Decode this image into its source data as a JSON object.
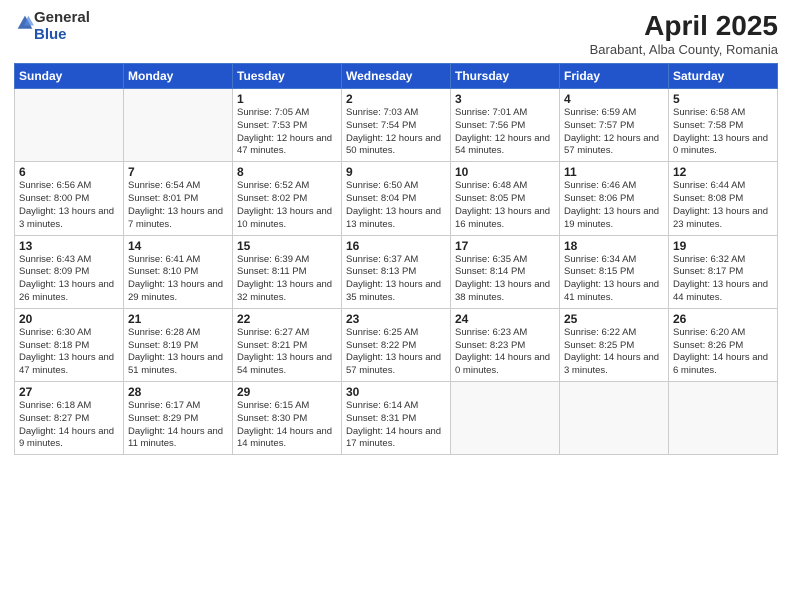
{
  "logo": {
    "general": "General",
    "blue": "Blue"
  },
  "title": "April 2025",
  "location": "Barabant, Alba County, Romania",
  "days_of_week": [
    "Sunday",
    "Monday",
    "Tuesday",
    "Wednesday",
    "Thursday",
    "Friday",
    "Saturday"
  ],
  "weeks": [
    [
      {
        "day": "",
        "info": ""
      },
      {
        "day": "",
        "info": ""
      },
      {
        "day": "1",
        "info": "Sunrise: 7:05 AM\nSunset: 7:53 PM\nDaylight: 12 hours and 47 minutes."
      },
      {
        "day": "2",
        "info": "Sunrise: 7:03 AM\nSunset: 7:54 PM\nDaylight: 12 hours and 50 minutes."
      },
      {
        "day": "3",
        "info": "Sunrise: 7:01 AM\nSunset: 7:56 PM\nDaylight: 12 hours and 54 minutes."
      },
      {
        "day": "4",
        "info": "Sunrise: 6:59 AM\nSunset: 7:57 PM\nDaylight: 12 hours and 57 minutes."
      },
      {
        "day": "5",
        "info": "Sunrise: 6:58 AM\nSunset: 7:58 PM\nDaylight: 13 hours and 0 minutes."
      }
    ],
    [
      {
        "day": "6",
        "info": "Sunrise: 6:56 AM\nSunset: 8:00 PM\nDaylight: 13 hours and 3 minutes."
      },
      {
        "day": "7",
        "info": "Sunrise: 6:54 AM\nSunset: 8:01 PM\nDaylight: 13 hours and 7 minutes."
      },
      {
        "day": "8",
        "info": "Sunrise: 6:52 AM\nSunset: 8:02 PM\nDaylight: 13 hours and 10 minutes."
      },
      {
        "day": "9",
        "info": "Sunrise: 6:50 AM\nSunset: 8:04 PM\nDaylight: 13 hours and 13 minutes."
      },
      {
        "day": "10",
        "info": "Sunrise: 6:48 AM\nSunset: 8:05 PM\nDaylight: 13 hours and 16 minutes."
      },
      {
        "day": "11",
        "info": "Sunrise: 6:46 AM\nSunset: 8:06 PM\nDaylight: 13 hours and 19 minutes."
      },
      {
        "day": "12",
        "info": "Sunrise: 6:44 AM\nSunset: 8:08 PM\nDaylight: 13 hours and 23 minutes."
      }
    ],
    [
      {
        "day": "13",
        "info": "Sunrise: 6:43 AM\nSunset: 8:09 PM\nDaylight: 13 hours and 26 minutes."
      },
      {
        "day": "14",
        "info": "Sunrise: 6:41 AM\nSunset: 8:10 PM\nDaylight: 13 hours and 29 minutes."
      },
      {
        "day": "15",
        "info": "Sunrise: 6:39 AM\nSunset: 8:11 PM\nDaylight: 13 hours and 32 minutes."
      },
      {
        "day": "16",
        "info": "Sunrise: 6:37 AM\nSunset: 8:13 PM\nDaylight: 13 hours and 35 minutes."
      },
      {
        "day": "17",
        "info": "Sunrise: 6:35 AM\nSunset: 8:14 PM\nDaylight: 13 hours and 38 minutes."
      },
      {
        "day": "18",
        "info": "Sunrise: 6:34 AM\nSunset: 8:15 PM\nDaylight: 13 hours and 41 minutes."
      },
      {
        "day": "19",
        "info": "Sunrise: 6:32 AM\nSunset: 8:17 PM\nDaylight: 13 hours and 44 minutes."
      }
    ],
    [
      {
        "day": "20",
        "info": "Sunrise: 6:30 AM\nSunset: 8:18 PM\nDaylight: 13 hours and 47 minutes."
      },
      {
        "day": "21",
        "info": "Sunrise: 6:28 AM\nSunset: 8:19 PM\nDaylight: 13 hours and 51 minutes."
      },
      {
        "day": "22",
        "info": "Sunrise: 6:27 AM\nSunset: 8:21 PM\nDaylight: 13 hours and 54 minutes."
      },
      {
        "day": "23",
        "info": "Sunrise: 6:25 AM\nSunset: 8:22 PM\nDaylight: 13 hours and 57 minutes."
      },
      {
        "day": "24",
        "info": "Sunrise: 6:23 AM\nSunset: 8:23 PM\nDaylight: 14 hours and 0 minutes."
      },
      {
        "day": "25",
        "info": "Sunrise: 6:22 AM\nSunset: 8:25 PM\nDaylight: 14 hours and 3 minutes."
      },
      {
        "day": "26",
        "info": "Sunrise: 6:20 AM\nSunset: 8:26 PM\nDaylight: 14 hours and 6 minutes."
      }
    ],
    [
      {
        "day": "27",
        "info": "Sunrise: 6:18 AM\nSunset: 8:27 PM\nDaylight: 14 hours and 9 minutes."
      },
      {
        "day": "28",
        "info": "Sunrise: 6:17 AM\nSunset: 8:29 PM\nDaylight: 14 hours and 11 minutes."
      },
      {
        "day": "29",
        "info": "Sunrise: 6:15 AM\nSunset: 8:30 PM\nDaylight: 14 hours and 14 minutes."
      },
      {
        "day": "30",
        "info": "Sunrise: 6:14 AM\nSunset: 8:31 PM\nDaylight: 14 hours and 17 minutes."
      },
      {
        "day": "",
        "info": ""
      },
      {
        "day": "",
        "info": ""
      },
      {
        "day": "",
        "info": ""
      }
    ]
  ]
}
